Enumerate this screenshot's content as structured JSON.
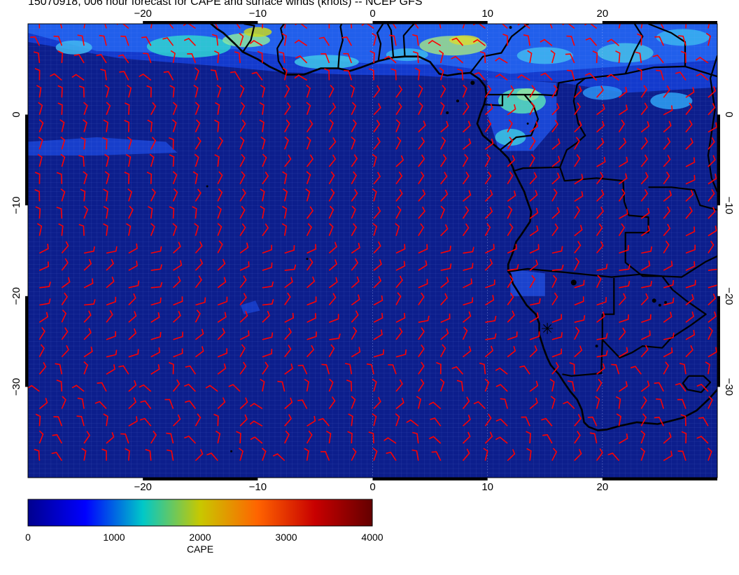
{
  "title": "15070918, 006 hour forecast for CAPE and surface winds (knots) -- NCEP GFS",
  "map": {
    "lon_range": [
      -30,
      30
    ],
    "lat_range": [
      -40,
      10
    ],
    "lon_ticks": [
      -20,
      -10,
      0,
      10,
      20
    ],
    "lat_ticks": [
      0,
      -10,
      -20,
      -30
    ],
    "lon_tick_labels": [
      "−20",
      "−10",
      "0",
      "10",
      "20"
    ],
    "lat_tick_labels": [
      "0",
      "−10",
      "−20",
      "−30"
    ],
    "colors": {
      "ocean_base": "#0c1e8c",
      "land_outline": "#000000",
      "wind_barb": "#ff0000",
      "axis_frame": "#000000"
    },
    "wind_units": "knots"
  },
  "colorbar": {
    "label": "CAPE",
    "range": [
      0,
      4000
    ],
    "tick_values": [
      0,
      1000,
      2000,
      3000,
      4000
    ],
    "tick_labels": [
      "0",
      "1000",
      "2000",
      "3000",
      "4000"
    ],
    "stops": [
      "#00008f",
      "#0000ff",
      "#00c8c8",
      "#c8c800",
      "#ff6400",
      "#c80000",
      "#640000"
    ]
  }
}
